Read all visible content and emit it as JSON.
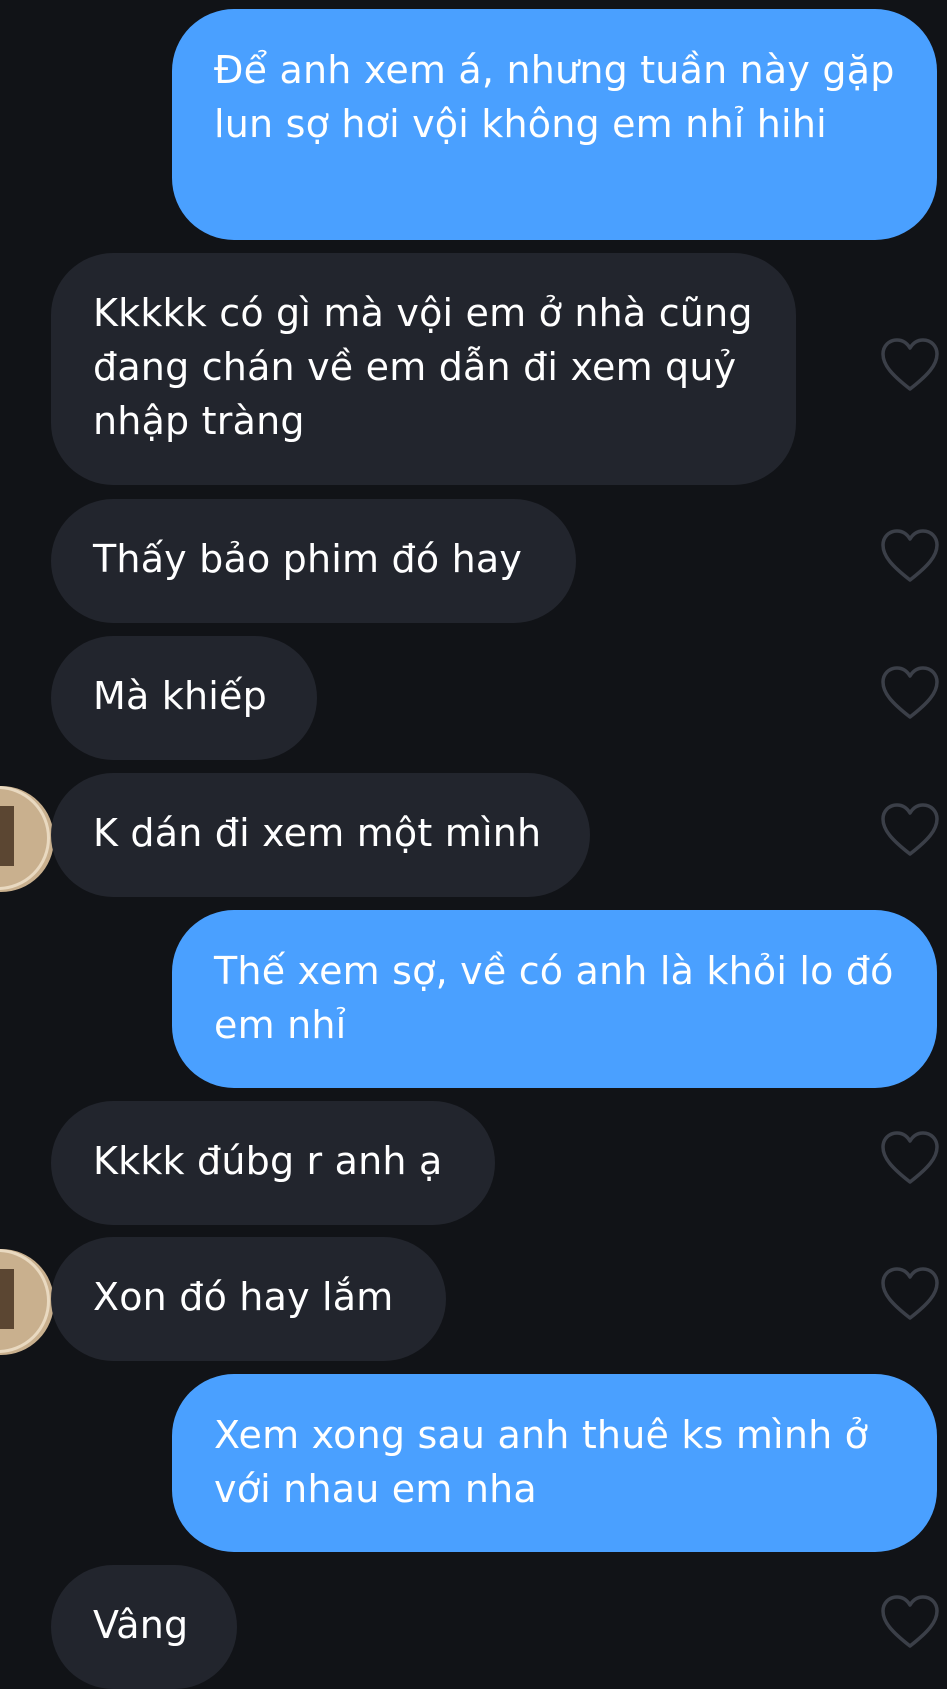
{
  "messages": [
    {
      "id": 1,
      "direction": "outgoing",
      "text": "Để anh xem á, nhưng tuần này gặp lun sợ hơi vội không em nhỉ hihi"
    },
    {
      "id": 2,
      "direction": "incoming",
      "text": "Kkkkk có gì mà vội em ở nhà cũng đang chán về em dẫn đi xem quỷ nhập tràng"
    },
    {
      "id": 3,
      "direction": "incoming",
      "text": "Thấy bảo phim đó hay"
    },
    {
      "id": 4,
      "direction": "incoming",
      "text": "Mà khiếp"
    },
    {
      "id": 5,
      "direction": "incoming",
      "text": "K dán đi xem một mình"
    },
    {
      "id": 6,
      "direction": "outgoing",
      "text": "Thế xem sợ, về có anh là khỏi lo đó em nhỉ"
    },
    {
      "id": 7,
      "direction": "incoming",
      "text": "Kkkk đúbg r anh ạ"
    },
    {
      "id": 8,
      "direction": "incoming",
      "text": "Xon đó hay lắm"
    },
    {
      "id": 9,
      "direction": "outgoing",
      "text": "Xem xong sau anh thuê ks mình ở với nhau em nha"
    },
    {
      "id": 10,
      "direction": "incoming",
      "text": "Vâng"
    }
  ],
  "theme": {
    "background": "#111317",
    "outgoing_bubble": "#4aa0ff",
    "incoming_bubble": "#22252d",
    "text": "#ffffff",
    "heart_outline": "#3b3f48"
  },
  "icons": {
    "like": "heart-outline-icon",
    "avatar": "contact-avatar"
  }
}
